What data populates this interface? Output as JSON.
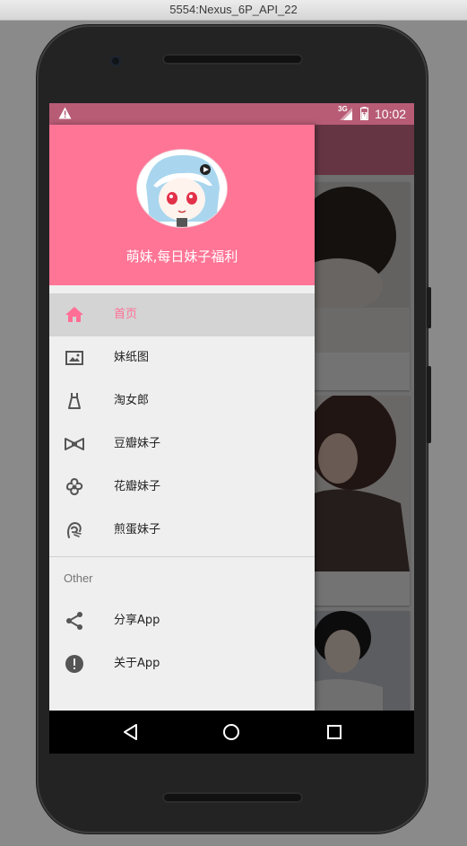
{
  "window": {
    "title": "5554:Nexus_6P_API_22"
  },
  "status_bar": {
    "time": "10:02",
    "network": "3G",
    "warning_icon": "warning-icon"
  },
  "drawer": {
    "header_title": "萌妹,每日妹子福利",
    "items": [
      {
        "label": "首页",
        "icon": "home-icon",
        "selected": true
      },
      {
        "label": "妹纸图",
        "icon": "image-icon",
        "selected": false
      },
      {
        "label": "淘女郎",
        "icon": "dress-icon",
        "selected": false
      },
      {
        "label": "豆瓣妹子",
        "icon": "bowtie-icon",
        "selected": false
      },
      {
        "label": "花瓣妹子",
        "icon": "flower-icon",
        "selected": false
      },
      {
        "label": "煎蛋妹子",
        "icon": "girl-icon",
        "selected": false
      }
    ],
    "section_header": "Other",
    "other_items": [
      {
        "label": "分享App",
        "icon": "share-icon"
      },
      {
        "label": "关于App",
        "icon": "info-icon"
      }
    ]
  },
  "nav_bar": {
    "buttons": [
      "back",
      "home",
      "recents"
    ]
  },
  "colors": {
    "accent": "#ff6f95",
    "header": "#ff7596",
    "status_bar": "#b85c76",
    "toolbar": "#e07796"
  }
}
